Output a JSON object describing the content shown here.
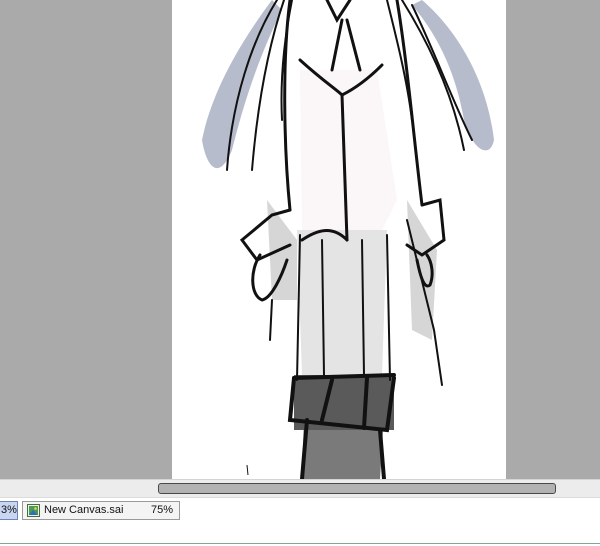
{
  "colors": {
    "workspace": "#aaaaaa",
    "canvas": "#ffffff",
    "hair_shadow": "#a9b0c2",
    "stroke": "#111111",
    "boot_fill": "#7a7a7a"
  },
  "document_tabs": [
    {
      "zoom": "3%"
    },
    {
      "name": "New Canvas.sai",
      "zoom": "75%",
      "icon": "image-file-icon"
    }
  ]
}
